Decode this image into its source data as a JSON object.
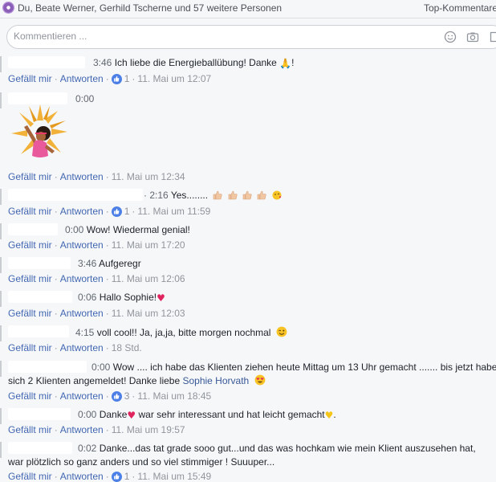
{
  "header": {
    "reactors": "Du, Beate Werner, Gerhild Tscherne und 57 weitere Personen",
    "sort_label": "Top-Kommentare"
  },
  "composer": {
    "placeholder": "Kommentieren ...",
    "icons": [
      "emoji-icon",
      "camera-icon",
      "sticker-icon"
    ]
  },
  "actions": {
    "like": "Gefällt mir",
    "reply": "Antworten",
    "separator": "·"
  },
  "comments": [
    {
      "time": "3:46",
      "text": "Ich liebe die Energieballübung! Danke",
      "trail": "!",
      "likes": "1",
      "date": "11. Mai um 12:07"
    },
    {
      "time": "0:00",
      "text": "",
      "likes": "",
      "date": "11. Mai um 12:34"
    },
    {
      "time": "2:16",
      "text": "Yes........",
      "likes": "1",
      "date": "11. Mai um 11:59"
    },
    {
      "time": "0:00",
      "text": "Wow! Wiedermal genial!",
      "likes": "",
      "date": "11. Mai um 17:20"
    },
    {
      "time": "3:46",
      "text": "Aufgeregr",
      "likes": "",
      "date": "11. Mai um 12:06"
    },
    {
      "time": "0:06",
      "text": "Hallo Sophie!",
      "likes": "",
      "date": "11. Mai um 12:03"
    },
    {
      "time": "4:15",
      "text": "voll cool!! Ja, ja,ja, bitte morgen nochmal",
      "likes": "",
      "date": "18 Std."
    },
    {
      "time": "0:00",
      "text": "Wow .... ich habe das Klienten ziehen heute Mittag um 13 Uhr gemacht ....... bis jetzt haben",
      "text2": "sich 2 Klienten angemeldet! Danke liebe",
      "mention": "Sophie Horvath",
      "likes": "3",
      "date": "11. Mai um 18:45"
    },
    {
      "time": "0:00",
      "text": "Danke",
      "text_b": "war sehr interessant und hat leicht gemacht",
      "trail": ".",
      "likes": "",
      "date": "11. Mai um 19:57"
    },
    {
      "time": "0:02",
      "text": "Danke...das tat grade sooo gut...und das was hochkam wie mein Klient auszusehen hat,",
      "text2": "war plötzlich so ganz anders und so viel stimmiger ! Suuuper...",
      "likes": "1",
      "date": "11. Mai um 15:49"
    }
  ],
  "colors": {
    "link": "#4267b2",
    "like_badge": "#4c80e6",
    "meta": "#90949c",
    "background": "#f6f7f9"
  }
}
